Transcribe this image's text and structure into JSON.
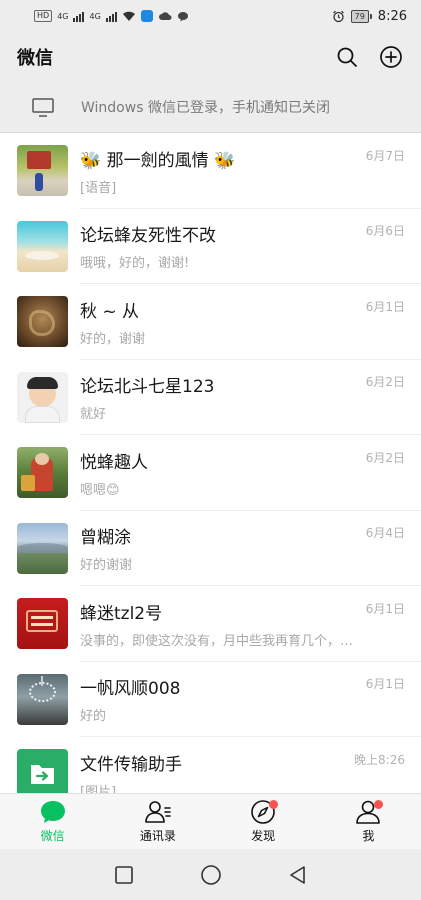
{
  "status_bar": {
    "hd_label": "HD",
    "network_1": "4G",
    "network_2": "4G",
    "battery": "79",
    "time": "8:26"
  },
  "header": {
    "title": "微信",
    "search_icon": "search-icon",
    "add_icon": "plus-circle-icon"
  },
  "banner": {
    "icon": "monitor-icon",
    "text": "Windows 微信已登录，手机通知已关闭"
  },
  "chats": [
    {
      "name": "🐝 那一劍的風情 🐝",
      "date": "6月7日",
      "message": "[语音]"
    },
    {
      "name": "论坛蜂友死性不改",
      "date": "6月6日",
      "message": "哦哦，好的，谢谢!"
    },
    {
      "name": "秋 ~ 从",
      "date": "6月1日",
      "message": "好的，谢谢"
    },
    {
      "name": "论坛北斗七星123",
      "date": "6月2日",
      "message": "就好"
    },
    {
      "name": "悦蜂趣人",
      "date": "6月2日",
      "message": "嗯嗯😊"
    },
    {
      "name": "曾糊涂",
      "date": "6月4日",
      "message": "好的谢谢"
    },
    {
      "name": "蜂迷tzl2号",
      "date": "6月1日",
      "message": "没事的，即使这次没有，月中些我再育几个，…"
    },
    {
      "name": "一帆风顺008",
      "date": "6月1日",
      "message": "好的"
    },
    {
      "name": "文件传输助手",
      "date": "晚上8:26",
      "message": "[图片]"
    }
  ],
  "tabs": [
    {
      "label": "微信",
      "icon": "chat-bubble-icon",
      "active": true
    },
    {
      "label": "通讯录",
      "icon": "contacts-icon",
      "active": false
    },
    {
      "label": "发现",
      "icon": "compass-icon",
      "active": false
    },
    {
      "label": "我",
      "icon": "person-icon",
      "active": false
    }
  ],
  "colors": {
    "accent": "#07c160",
    "badge": "#fa5151",
    "background": "#ededed"
  }
}
